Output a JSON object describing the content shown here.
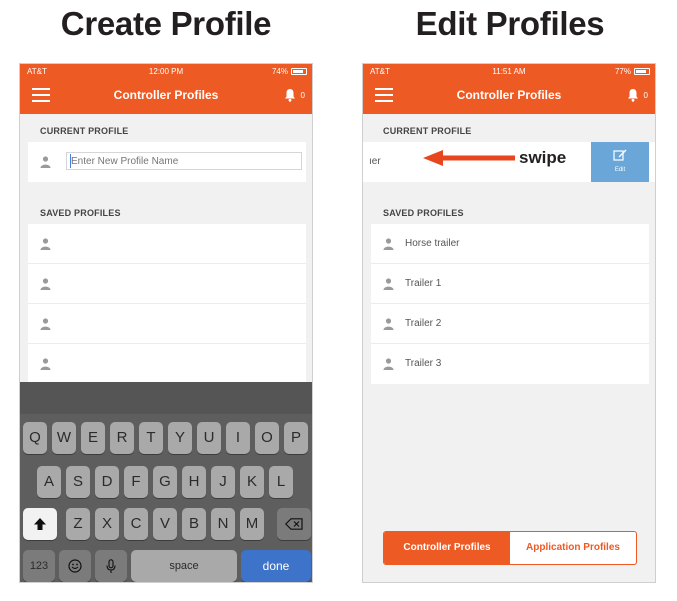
{
  "headings": {
    "left": "Create Profile",
    "right": "Edit Profiles"
  },
  "colors": {
    "accent": "#ee5a24",
    "edit_action": "#6aa7d8",
    "keyboard": "#5e5e5e"
  },
  "left_phone": {
    "status": {
      "carrier": "AT&T",
      "time": "12:00 PM",
      "battery": "74%"
    },
    "appbar": {
      "title": "Controller Profiles",
      "bell_count": "0"
    },
    "current_profile_label": "CURRENT PROFILE",
    "input_placeholder": "Enter New Profile Name",
    "saved_profiles_label": "SAVED PROFILES",
    "saved_rows": [
      "",
      "",
      "",
      ""
    ],
    "keyboard": {
      "row1": [
        "Q",
        "W",
        "E",
        "R",
        "T",
        "Y",
        "U",
        "I",
        "O",
        "P"
      ],
      "row2": [
        "A",
        "S",
        "D",
        "F",
        "G",
        "H",
        "J",
        "K",
        "L"
      ],
      "row3": [
        "Z",
        "X",
        "C",
        "V",
        "B",
        "N",
        "M"
      ],
      "numbers_key": "123",
      "space_key": "space",
      "done_key": "done"
    }
  },
  "right_phone": {
    "status": {
      "carrier": "AT&T",
      "time": "11:51 AM",
      "battery": "77%"
    },
    "appbar": {
      "title": "Controller Profiles",
      "bell_count": "0"
    },
    "current_profile_label": "CURRENT PROFILE",
    "swiped_text": "ıer",
    "edit_label": "Edit",
    "swipe_annotation": "swipe",
    "saved_profiles_label": "SAVED PROFILES",
    "saved_profiles": [
      "Horse trailer",
      "Trailer 1",
      "Trailer 2",
      "Trailer 3"
    ],
    "tabs": {
      "controller": "Controller Profiles",
      "application": "Application Profiles"
    }
  }
}
